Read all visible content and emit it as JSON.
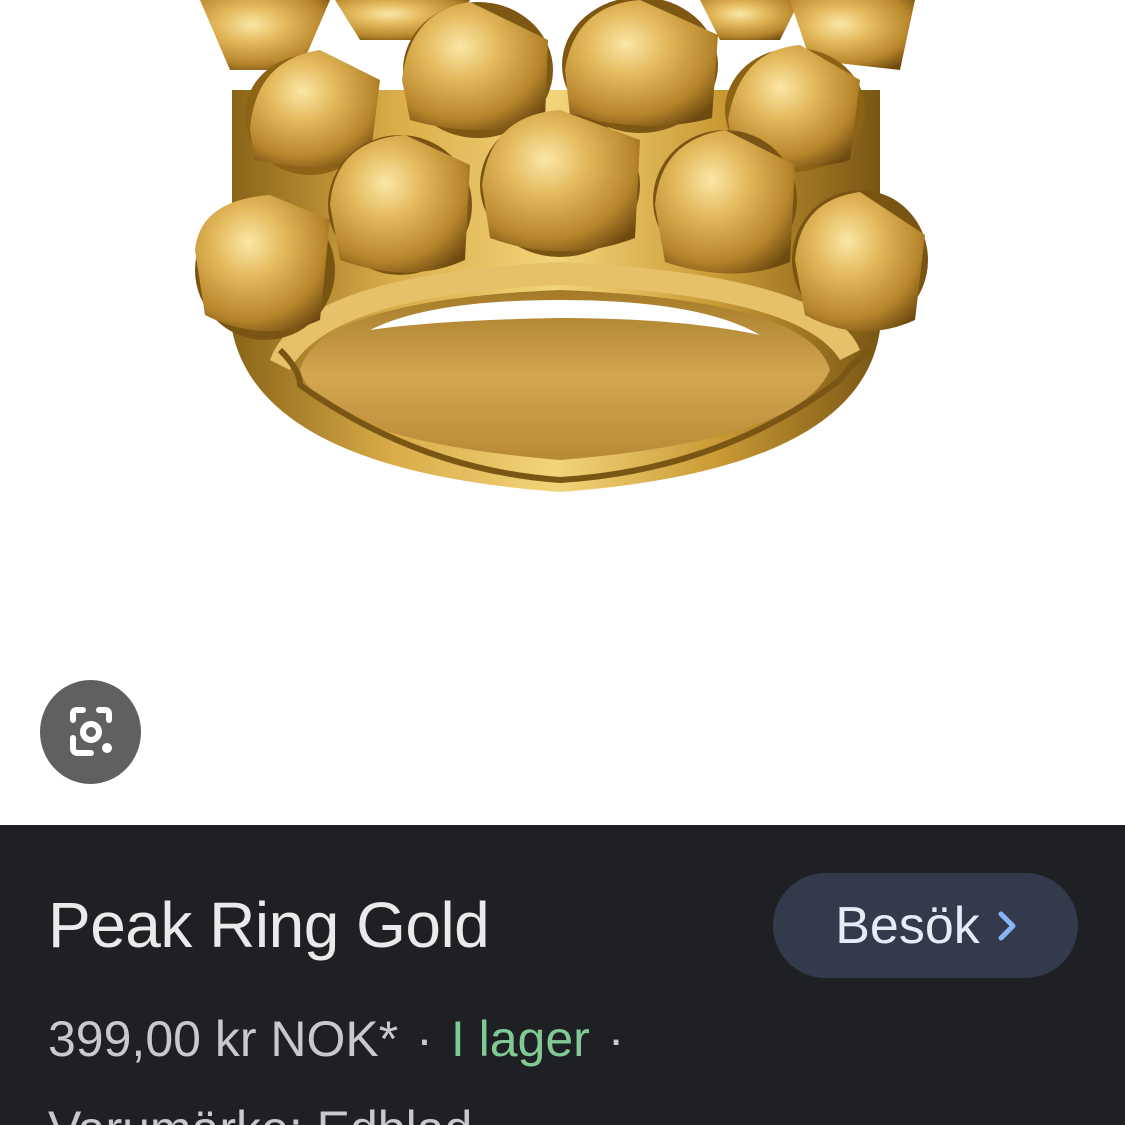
{
  "product": {
    "title": "Peak Ring Gold",
    "price": "399,00 kr NOK*",
    "separator": "·",
    "stock_status": "I lager",
    "brand_line": "Varumärke: Edblad",
    "image_alt": "Peak Ring Gold"
  },
  "actions": {
    "visit_label": "Besök",
    "visit_icon": "chevron-right-icon",
    "lens_icon": "google-lens-icon"
  },
  "colors": {
    "panel_background": "#1f2023",
    "visit_button_background": "#323a4b",
    "stock_green": "#81c995",
    "chevron_blue": "#8ab4f8",
    "lens_button_background": "#5f6061",
    "gold": "#d4a83a"
  }
}
